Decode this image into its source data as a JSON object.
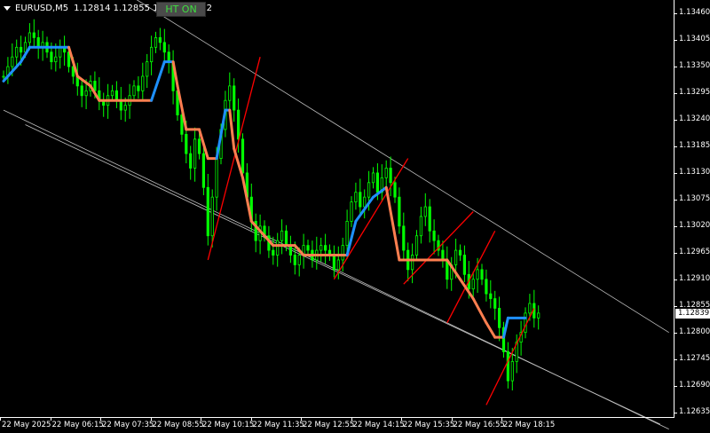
{
  "header": {
    "symbol": "EURUSD,M5",
    "quotes": "1.12814 1.12855 1.12813 1.12",
    "button_label": "HT ON"
  },
  "colors": {
    "background": "#000000",
    "candles": "#00ff00",
    "trend_down": "#ff7f50",
    "trend_up": "#1e90ff",
    "trendlines": "#ff0000",
    "channel": "#c0c0c0",
    "axis": "#ffffff"
  },
  "chart_data": {
    "type": "candlestick",
    "title": "",
    "price_axis_labels": [
      "1.13460",
      "1.13405",
      "1.13350",
      "1.13295",
      "1.13240",
      "1.13185",
      "1.13130",
      "1.13075",
      "1.13020",
      "1.12965",
      "1.12910",
      "1.12855",
      "1.12800",
      "1.12745",
      "1.12690",
      "1.12635"
    ],
    "time_axis_labels": [
      "22 May 2025",
      "22 May 06:15",
      "22 May 07:35",
      "22 May 08:55",
      "22 May 10:15",
      "22 May 11:35",
      "22 May 12:55",
      "22 May 14:15",
      "22 May 15:35",
      "22 May 16:55",
      "22 May 18:15"
    ],
    "current_price": "1.12839",
    "ylim": [
      1.12625,
      1.13475
    ],
    "close": [
      1.1333,
      1.1335,
      1.1337,
      1.1339,
      1.1338,
      1.134,
      1.1342,
      1.1341,
      1.1339,
      1.134,
      1.1338,
      1.1336,
      1.1337,
      1.1339,
      1.1338,
      1.1335,
      1.1333,
      1.1331,
      1.1329,
      1.133,
      1.1332,
      1.133,
      1.1328,
      1.1327,
      1.1329,
      1.133,
      1.1328,
      1.1326,
      1.1327,
      1.1329,
      1.1331,
      1.133,
      1.1333,
      1.1336,
      1.1339,
      1.1341,
      1.134,
      1.1338,
      1.1336,
      1.133,
      1.1325,
      1.1321,
      1.1317,
      1.1314,
      1.132,
      1.1317,
      1.131,
      1.13,
      1.1308,
      1.1316,
      1.1322,
      1.1328,
      1.1331,
      1.1326,
      1.132,
      1.1313,
      1.1308,
      1.1303,
      1.1299,
      1.1302,
      1.13,
      1.1297,
      1.1296,
      1.1299,
      1.1301,
      1.1298,
      1.1296,
      1.1294,
      1.1296,
      1.1298,
      1.1297,
      1.1295,
      1.1297,
      1.1298,
      1.1297,
      1.1296,
      1.1293,
      1.1295,
      1.1298,
      1.1303,
      1.1307,
      1.1309,
      1.1306,
      1.1308,
      1.1311,
      1.1313,
      1.1309,
      1.1312,
      1.1314,
      1.1311,
      1.1308,
      1.1302,
      1.1297,
      1.1293,
      1.1296,
      1.13,
      1.1304,
      1.1306,
      1.1301,
      1.1299,
      1.1297,
      1.1295,
      1.1291,
      1.1294,
      1.1297,
      1.1296,
      1.1292,
      1.1289,
      1.1291,
      1.1293,
      1.1291,
      1.1288,
      1.1287,
      1.1285,
      1.1281,
      1.1276,
      1.127,
      1.1274,
      1.1278,
      1.128,
      1.1284,
      1.1286,
      1.1283,
      1.1284
    ],
    "trend_line": [
      {
        "x": 0,
        "y": 1.1332,
        "c": "up"
      },
      {
        "x": 4,
        "y": 1.1336,
        "c": "up"
      },
      {
        "x": 6,
        "y": 1.1339,
        "c": "up"
      },
      {
        "x": 15,
        "y": 1.1339,
        "c": "down"
      },
      {
        "x": 17,
        "y": 1.1333,
        "c": "down"
      },
      {
        "x": 20,
        "y": 1.1331,
        "c": "down"
      },
      {
        "x": 22,
        "y": 1.1328,
        "c": "down"
      },
      {
        "x": 34,
        "y": 1.1328,
        "c": "up"
      },
      {
        "x": 37,
        "y": 1.1336,
        "c": "up"
      },
      {
        "x": 39,
        "y": 1.1336,
        "c": "down"
      },
      {
        "x": 40,
        "y": 1.1331,
        "c": "down"
      },
      {
        "x": 42,
        "y": 1.1322,
        "c": "down"
      },
      {
        "x": 45,
        "y": 1.1322,
        "c": "down"
      },
      {
        "x": 47,
        "y": 1.1316,
        "c": "down"
      },
      {
        "x": 49,
        "y": 1.1316,
        "c": "up"
      },
      {
        "x": 51,
        "y": 1.1326,
        "c": "up"
      },
      {
        "x": 52,
        "y": 1.1326,
        "c": "down"
      },
      {
        "x": 53,
        "y": 1.1318,
        "c": "down"
      },
      {
        "x": 55,
        "y": 1.1312,
        "c": "down"
      },
      {
        "x": 57,
        "y": 1.1303,
        "c": "down"
      },
      {
        "x": 60,
        "y": 1.13,
        "c": "down"
      },
      {
        "x": 62,
        "y": 1.1298,
        "c": "down"
      },
      {
        "x": 67,
        "y": 1.1298,
        "c": "down"
      },
      {
        "x": 69,
        "y": 1.1296,
        "c": "down"
      },
      {
        "x": 79,
        "y": 1.1296,
        "c": "up"
      },
      {
        "x": 81,
        "y": 1.1303,
        "c": "up"
      },
      {
        "x": 85,
        "y": 1.1308,
        "c": "up"
      },
      {
        "x": 88,
        "y": 1.131,
        "c": "down"
      },
      {
        "x": 91,
        "y": 1.1295,
        "c": "down"
      },
      {
        "x": 102,
        "y": 1.1295,
        "c": "down"
      },
      {
        "x": 105,
        "y": 1.1291,
        "c": "down"
      },
      {
        "x": 108,
        "y": 1.1287,
        "c": "down"
      },
      {
        "x": 111,
        "y": 1.1282,
        "c": "down"
      },
      {
        "x": 113,
        "y": 1.1279,
        "c": "down"
      },
      {
        "x": 115,
        "y": 1.1279,
        "c": "up"
      },
      {
        "x": 116,
        "y": 1.1283,
        "c": "up"
      },
      {
        "x": 120,
        "y": 1.1283,
        "c": "up"
      }
    ],
    "trendlines": [
      {
        "x1": 47,
        "y1": 1.1295,
        "x2": 59,
        "y2": 1.1337
      },
      {
        "x1": 76,
        "y1": 1.1291,
        "x2": 93,
        "y2": 1.1316
      },
      {
        "x1": 92,
        "y1": 1.129,
        "x2": 108,
        "y2": 1.1305
      },
      {
        "x1": 102,
        "y1": 1.1282,
        "x2": 113,
        "y2": 1.1301
      },
      {
        "x1": 111,
        "y1": 1.1265,
        "x2": 122,
        "y2": 1.1285
      }
    ],
    "channel": [
      {
        "x1": 25,
        "y1": 1.1352,
        "x2": 153,
        "y2": 1.128
      },
      {
        "x1": 0,
        "y1": 1.1326,
        "x2": 153,
        "y2": 1.126
      },
      {
        "x1": 5,
        "y1": 1.1323,
        "x2": 151,
        "y2": 1.1261
      }
    ]
  }
}
